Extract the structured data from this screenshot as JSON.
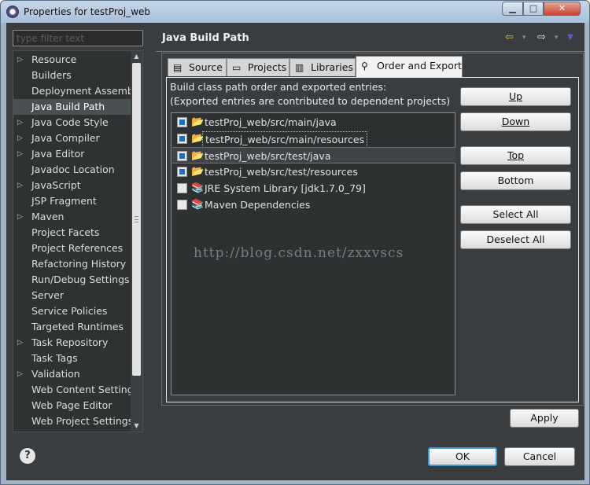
{
  "window": {
    "title": "Properties for testProj_web",
    "min_glyph": "▁",
    "max_glyph": "□",
    "close_glyph": "✕"
  },
  "filter": {
    "placeholder": "type filter text"
  },
  "nav": {
    "items": [
      {
        "label": "Resource",
        "expandable": true
      },
      {
        "label": "Builders",
        "expandable": false
      },
      {
        "label": "Deployment Assembly",
        "expandable": false
      },
      {
        "label": "Java Build Path",
        "expandable": false,
        "selected": true
      },
      {
        "label": "Java Code Style",
        "expandable": true
      },
      {
        "label": "Java Compiler",
        "expandable": true
      },
      {
        "label": "Java Editor",
        "expandable": true
      },
      {
        "label": "Javadoc Location",
        "expandable": false
      },
      {
        "label": "JavaScript",
        "expandable": true
      },
      {
        "label": "JSP Fragment",
        "expandable": false
      },
      {
        "label": "Maven",
        "expandable": true
      },
      {
        "label": "Project Facets",
        "expandable": false
      },
      {
        "label": "Project References",
        "expandable": false
      },
      {
        "label": "Refactoring History",
        "expandable": false
      },
      {
        "label": "Run/Debug Settings",
        "expandable": false
      },
      {
        "label": "Server",
        "expandable": false
      },
      {
        "label": "Service Policies",
        "expandable": false
      },
      {
        "label": "Targeted Runtimes",
        "expandable": false
      },
      {
        "label": "Task Repository",
        "expandable": true
      },
      {
        "label": "Task Tags",
        "expandable": false
      },
      {
        "label": "Validation",
        "expandable": true
      },
      {
        "label": "Web Content Settings",
        "expandable": false
      },
      {
        "label": "Web Page Editor",
        "expandable": false
      },
      {
        "label": "Web Project Settings",
        "expandable": false
      }
    ]
  },
  "page": {
    "title": "Java Build Path",
    "nav_icons": {
      "back": "⇦",
      "forward": "⇨",
      "dropdown": "▾",
      "menu": "▼"
    }
  },
  "tabs": [
    {
      "label": "Source",
      "icon": "source-folder-icon",
      "glyph": "▤"
    },
    {
      "label": "Projects",
      "icon": "projects-icon",
      "glyph": "▭"
    },
    {
      "label": "Libraries",
      "icon": "libraries-icon",
      "glyph": "▥"
    },
    {
      "label": "Order and Export",
      "icon": "order-export-icon",
      "glyph": "⚲",
      "active": true
    }
  ],
  "order_export": {
    "description_line1": "Build class path order and exported entries:",
    "description_line2": "(Exported entries are contributed to dependent projects)",
    "entries": [
      {
        "label": "testProj_web/src/main/java",
        "checked": true,
        "icon": "package-folder-icon",
        "glyph": "📂"
      },
      {
        "label": "testProj_web/src/main/resources",
        "checked": true,
        "icon": "package-folder-icon",
        "glyph": "📂",
        "focused": true
      },
      {
        "label": "testProj_web/src/test/java",
        "checked": true,
        "icon": "package-folder-icon",
        "glyph": "📂",
        "selected": true
      },
      {
        "label": "testProj_web/src/test/resources",
        "checked": true,
        "icon": "package-folder-icon",
        "glyph": "📂"
      },
      {
        "label": "JRE System Library [jdk1.7.0_79]",
        "checked": false,
        "icon": "library-icon",
        "glyph": "📚"
      },
      {
        "label": "Maven Dependencies",
        "checked": false,
        "icon": "library-icon",
        "glyph": "📚"
      }
    ],
    "buttons": {
      "up": "Up",
      "down": "Down",
      "top": "Top",
      "bottom": "Bottom",
      "select_all": "Select All",
      "deselect_all": "Deselect All"
    }
  },
  "watermark": "http://blog.csdn.net/zxxvscs",
  "footer": {
    "apply": "Apply",
    "ok": "OK",
    "cancel": "Cancel",
    "help_glyph": "?"
  },
  "colors": {
    "background": "#393d3f",
    "accent_focus": "#3c9ad8",
    "checkbox_fill": "#1f6fbf"
  }
}
